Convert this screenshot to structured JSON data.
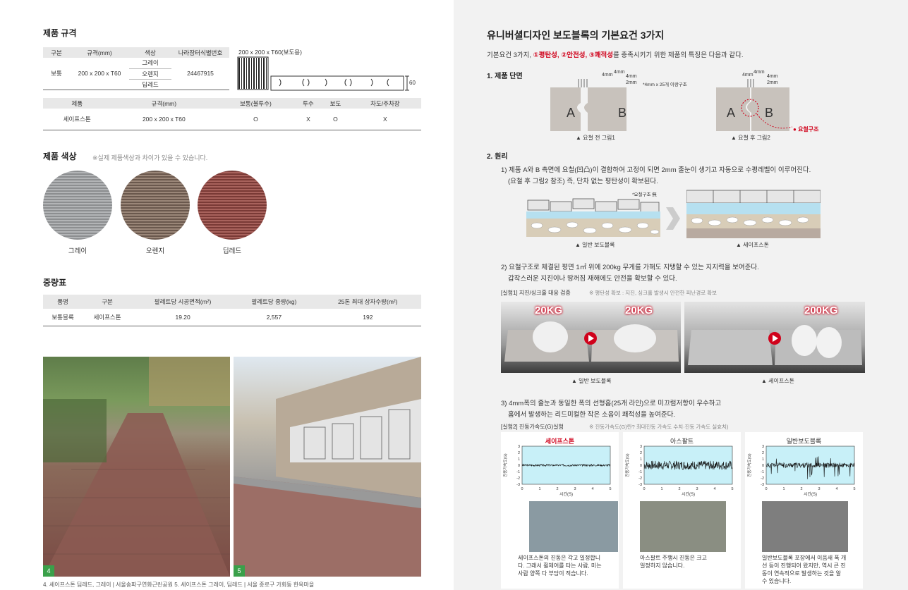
{
  "left": {
    "spec_heading": "제품 규격",
    "spec_table": {
      "headers": [
        "구분",
        "규격(mm)",
        "색상",
        "나라장터식별번호"
      ],
      "row": {
        "type": "보통",
        "size": "200 x 200 x T60",
        "colors": [
          "그레이",
          "오렌지",
          "딥레드"
        ],
        "id": "24467915"
      }
    },
    "drawing_label": "200 x 200 x T60(보도용)",
    "drawing_dim": "60",
    "usage_table": {
      "headers": [
        "제품",
        "규격(mm)",
        "보통(불투수)",
        "투수",
        "보도",
        "차도/주차장"
      ],
      "row": [
        "세이프스톤",
        "200 x 200 x T60",
        "O",
        "X",
        "O",
        "X"
      ]
    },
    "color_heading": "제품 색상",
    "color_note": "※실제 제품색상과 차이가 있을 수 있습니다.",
    "swatches": [
      {
        "label": "그레이",
        "color": "#9a9c9e"
      },
      {
        "label": "오렌지",
        "color": "#7d6a5f"
      },
      {
        "label": "딥레드",
        "color": "#8a4a45"
      }
    ],
    "weight_heading": "중량표",
    "weight_table": {
      "headers": [
        "품명",
        "구분",
        "팔레트당 시공면적(m²)",
        "팔레트당 중량(kg)",
        "25톤 최대 상자수량(m²)"
      ],
      "row": [
        "보통블록",
        "세이프스톤",
        "19.20",
        "2,557",
        "192"
      ]
    },
    "photo_numbers": [
      "4",
      "5"
    ],
    "photo_caption": "4. 세이프스톤 딥레드, 그레이 | 서울송파구연화근린공원  5. 세이프스톤 그레이, 딥레드 | 서울 종로구 가회동 한옥마을"
  },
  "right": {
    "title": "유니버셜디자인 보도블록의 기본요건 3가지",
    "intro_pre": "기본요건 3가지, ",
    "intro_red": "①평탄성, ②안전성, ③쾌적성",
    "intro_post": "를 충족시키기 위한 제품의 특징은 다음과 같다.",
    "sec1": "1. 제품 단면",
    "fig1": {
      "a": "A",
      "b": "B",
      "dims": [
        "4mm",
        "4mm",
        "4mm",
        "2mm"
      ],
      "note": "*4mm x 25개 이랑구조",
      "caption": "▲ 요철 전 그림1"
    },
    "fig2": {
      "a": "A",
      "b": "B",
      "dims": [
        "4mm",
        "4mm",
        "4mm",
        "2mm"
      ],
      "label": "요철구조",
      "caption": "▲ 요철 후 그림2"
    },
    "sec2": "2. 원리",
    "p1_line1": "1) 제품 A와 B 측면에 요철(凹凸)이 결합하여 고정이 되면 2mm 줄눈이 생기고 자동으로 수평레벨이 이루어진다.",
    "p1_line2": "(요철 후 그림2 참조) 즉, 단차 없는 평탄성이 확보된다.",
    "layer_note": "*요철구조 無",
    "layer_caption_left": "▲ 일반 보도블록",
    "layer_caption_right": "▲ 세이프스톤",
    "p2_line1": "2) 요철구조로 체결된 평면 1㎡ 위에 200kg 무게를 가해도 지탱할 수 있는 지지력을 보여준다.",
    "p2_line2": "갑작스러운 지진이나 땅꺼짐 재해에도 안전을 확보할 수 있다.",
    "exp1_label": "[실험1] 지진/싱크홀 대응 검증",
    "exp1_note": "※ 평탄성 확보 : 지진, 싱크홀 발생시 안전한 피난경로 확보",
    "weights": [
      "20KG",
      "20KG",
      "200KG"
    ],
    "photo_caption_left": "▲ 일반 보도블록",
    "photo_caption_right": "▲ 세이프스톤",
    "p3_line1": "3) 4mm폭의 줄눈과 동일한 폭의 선형홈(25개 라인)으로 미끄럼저항이 우수하고",
    "p3_line2": "홈에서 발생하는 리드미컬한 작은 소음이 쾌적성을 높여준다.",
    "exp2_label": "[실험2] 진동가속도(G)실험",
    "exp2_note": "※ 진동가속도(G)란? 최대진동 가속도 수치·진동 가속도 실효치)",
    "graphs": [
      {
        "title": "세이프스톤",
        "title_color": "#d0021b",
        "ylabel": "진동가속도(G)",
        "xlabel": "시간(S)",
        "yticks": [
          "3",
          "2",
          "1",
          "0",
          "-1",
          "-2",
          "-3"
        ],
        "xticks": [
          "0",
          "1",
          "2",
          "3",
          "4",
          "5"
        ],
        "desc": [
          "세이프스톤의 진동은 각고 일정합니",
          "다. 그래서 휠체어를 타는 사람, 미는",
          "사람 양쪽 다 부담이 적습니다."
        ]
      },
      {
        "title": "아스팔트",
        "title_color": "#333333",
        "ylabel": "진동가속도(G)",
        "xlabel": "시간(S)",
        "yticks": [
          "3",
          "2",
          "1",
          "0",
          "-1",
          "-2",
          "-3"
        ],
        "xticks": [
          "0",
          "1",
          "2",
          "3",
          "4",
          "5"
        ],
        "desc": [
          "아스팔트 주행시 진동은 크고",
          "일정하지 않습니다."
        ]
      },
      {
        "title": "일반보도블록",
        "title_color": "#333333",
        "ylabel": "진동가속도(G)",
        "xlabel": "시간(S)",
        "yticks": [
          "3",
          "2",
          "1",
          "0",
          "-1",
          "-2",
          "-3"
        ],
        "xticks": [
          "0",
          "1",
          "2",
          "3",
          "4",
          "5"
        ],
        "desc": [
          "일반보도블록 포장에서 이음새 폭 개",
          "선 등이 진행되어 왔지만, 역시 큰 진",
          "동이 연속적으로 발생하는 것을 알",
          "수 있습니다."
        ]
      }
    ]
  }
}
